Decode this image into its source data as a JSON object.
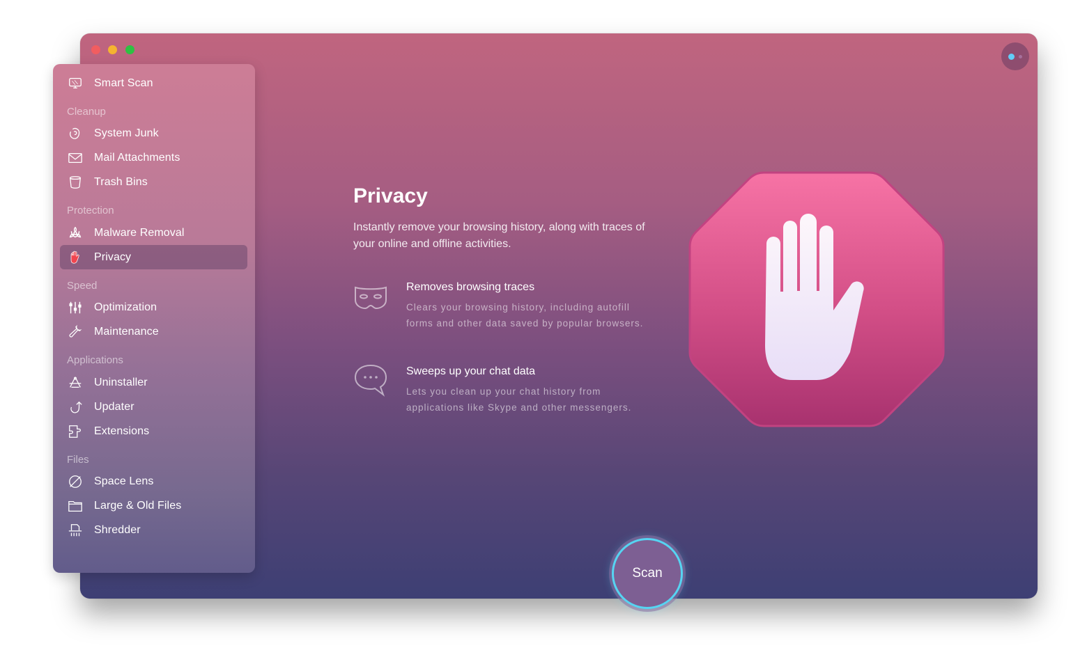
{
  "window": {
    "traffic_lights": [
      "close",
      "minimize",
      "maximize"
    ],
    "assistant_button": "assistant-icon"
  },
  "sidebar": {
    "top_item": {
      "label": "Smart Scan",
      "icon": "monitor-icon"
    },
    "sections": [
      {
        "header": "Cleanup",
        "items": [
          {
            "label": "System Junk",
            "icon": "system-junk-icon"
          },
          {
            "label": "Mail Attachments",
            "icon": "mail-icon"
          },
          {
            "label": "Trash Bins",
            "icon": "trash-icon"
          }
        ]
      },
      {
        "header": "Protection",
        "items": [
          {
            "label": "Malware Removal",
            "icon": "biohazard-icon"
          },
          {
            "label": "Privacy",
            "icon": "hand-icon",
            "active": true
          }
        ]
      },
      {
        "header": "Speed",
        "items": [
          {
            "label": "Optimization",
            "icon": "sliders-icon"
          },
          {
            "label": "Maintenance",
            "icon": "wrench-icon"
          }
        ]
      },
      {
        "header": "Applications",
        "items": [
          {
            "label": "Uninstaller",
            "icon": "uninstaller-icon"
          },
          {
            "label": "Updater",
            "icon": "updater-icon"
          },
          {
            "label": "Extensions",
            "icon": "puzzle-icon"
          }
        ]
      },
      {
        "header": "Files",
        "items": [
          {
            "label": "Space Lens",
            "icon": "planet-icon"
          },
          {
            "label": "Large & Old Files",
            "icon": "folder-icon"
          },
          {
            "label": "Shredder",
            "icon": "shredder-icon"
          }
        ]
      }
    ]
  },
  "main": {
    "title": "Privacy",
    "subtitle": "Instantly remove your browsing history, along with traces of your online and offline activities.",
    "features": [
      {
        "icon": "mask-icon",
        "title": "Removes browsing traces",
        "description": "Clears your browsing history, including autofill forms and other data saved by popular browsers."
      },
      {
        "icon": "chat-bubble-icon",
        "title": "Sweeps up your chat data",
        "description": "Lets you clean up your chat history from applications like Skype and other messengers."
      }
    ],
    "hero_icon": "stop-hand-icon",
    "scan_button": "Scan"
  },
  "colors": {
    "accent_ring": "#56d4f2",
    "close": "#f15d60",
    "minimize": "#f5b330",
    "maximize": "#2fc043",
    "hero_top": "#f773a5",
    "hero_bottom": "#a8326f"
  }
}
